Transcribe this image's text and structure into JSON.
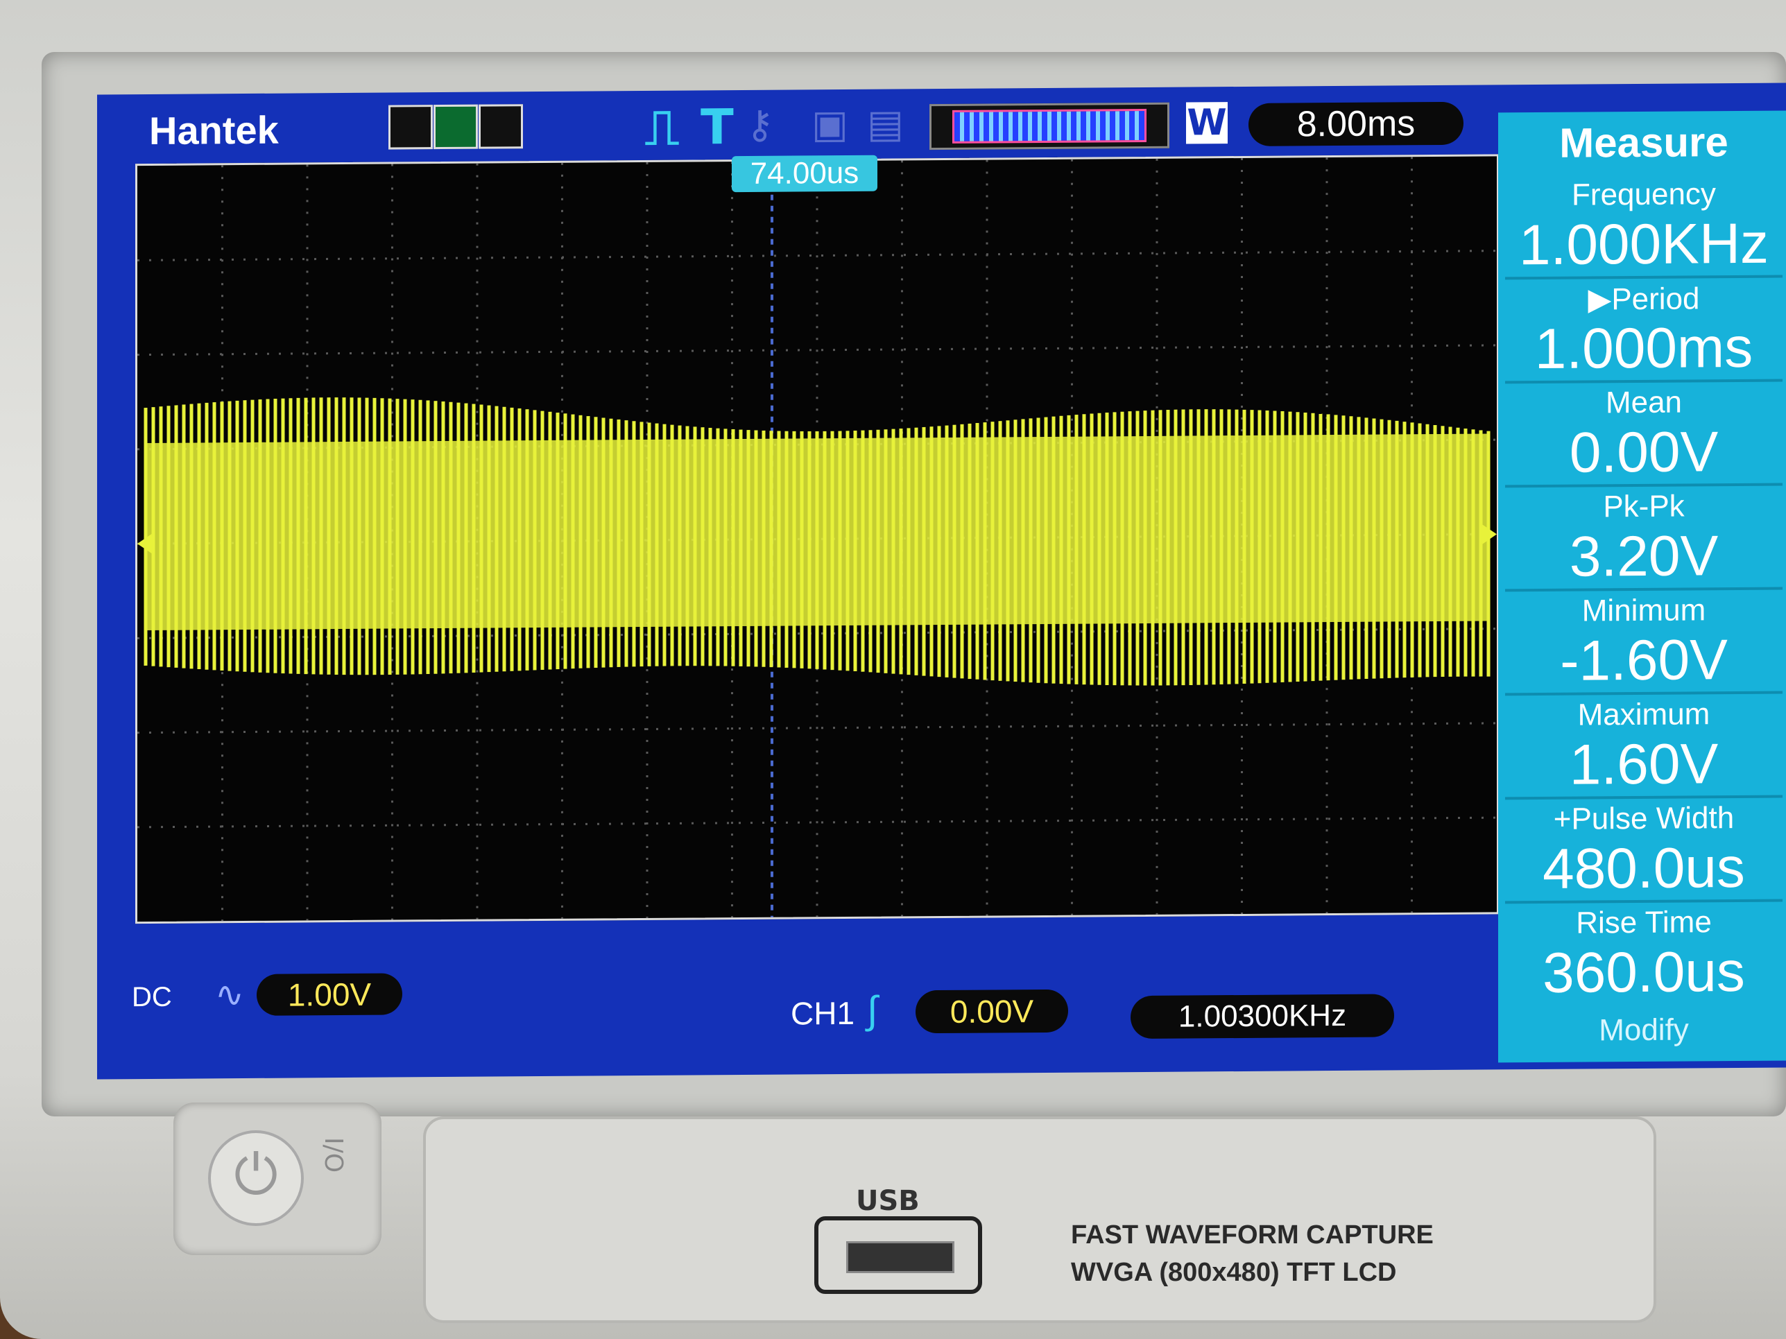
{
  "brand": "Hantek",
  "top_bar": {
    "timebase": "8.00ms",
    "window_badge": "W",
    "trigger_position": "74.00us"
  },
  "measure_panel": {
    "title": "Measure",
    "items": [
      {
        "label": "Frequency",
        "value": "1.000KHz"
      },
      {
        "label": "▶Period",
        "value": "1.000ms"
      },
      {
        "label": "Mean",
        "value": "0.00V"
      },
      {
        "label": "Pk-Pk",
        "value": "3.20V"
      },
      {
        "label": "Minimum",
        "value": "-1.60V"
      },
      {
        "label": "Maximum",
        "value": "1.60V"
      },
      {
        "label": "+Pulse Width",
        "value": "480.0us"
      },
      {
        "label": "Rise Time",
        "value": "360.0us"
      }
    ],
    "modify_label": "Modify"
  },
  "bottom_bar": {
    "coupling": "DC",
    "volts_div": "1.00V",
    "channel": "CH1",
    "trigger_level": "0.00V",
    "frequency_counter": "1.00300KHz"
  },
  "front_panel": {
    "usb_label": "USB",
    "caption_line1": "FAST WAVEFORM CAPTURE",
    "caption_line2": "WVGA (800x480) TFT LCD"
  },
  "colors": {
    "screen_bg": "#1431b8",
    "trace": "#e8f23a",
    "measure_panel": "#17b2da"
  }
}
